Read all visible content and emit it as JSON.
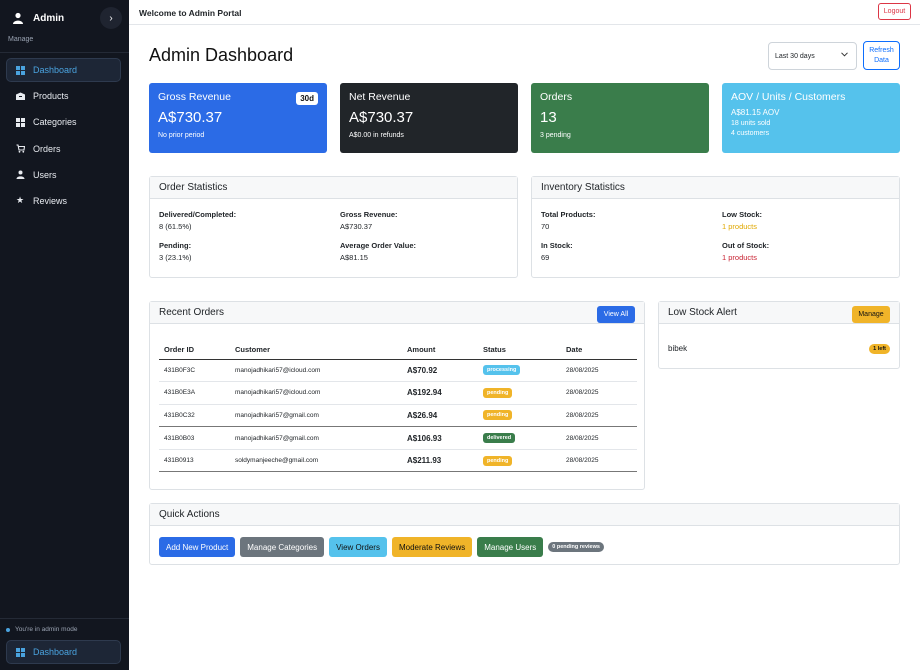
{
  "sidebar": {
    "user_name": "Admin",
    "section_label": "Manage",
    "items": [
      {
        "label": "Dashboard",
        "icon": "grid-icon",
        "active": true
      },
      {
        "label": "Products",
        "icon": "box-icon"
      },
      {
        "label": "Categories",
        "icon": "grid-icon"
      },
      {
        "label": "Orders",
        "icon": "cart-icon"
      },
      {
        "label": "Users",
        "icon": "user-icon"
      },
      {
        "label": "Reviews",
        "icon": "star-icon"
      }
    ],
    "mode_text": "You're in admin mode",
    "bottom_item": "Dashboard"
  },
  "topbar": {
    "title": "Welcome to Admin Portal",
    "logout": "Logout"
  },
  "header": {
    "title": "Admin Dashboard",
    "range_value": "Last 30 days",
    "refresh_line1": "Refresh",
    "refresh_line2": "Data"
  },
  "cards": [
    {
      "title": "Gross Revenue",
      "badge": "30d",
      "value": "A$730.37",
      "sub": "No prior period"
    },
    {
      "title": "Net Revenue",
      "value": "A$730.37",
      "sub": "A$0.00 in refunds"
    },
    {
      "title": "Orders",
      "value": "13",
      "sub": "3 pending"
    },
    {
      "title": "AOV / Units / Customers",
      "value": "A$81.15 AOV",
      "sub": "18 units sold",
      "sub2": "4 customers"
    }
  ],
  "order_stats": {
    "title": "Order Statistics",
    "delivered_label": "Delivered/Completed:",
    "delivered_value": "8 (61.5%)",
    "pending_label": "Pending:",
    "pending_value": "3 (23.1%)",
    "gross_label": "Gross Revenue:",
    "gross_value": "A$730.37",
    "aov_label": "Average Order Value:",
    "aov_value": "A$81.15"
  },
  "inventory_stats": {
    "title": "Inventory Statistics",
    "total_label": "Total Products:",
    "total_value": "70",
    "instock_label": "In Stock:",
    "instock_value": "69",
    "low_label": "Low Stock:",
    "low_value": "1 products",
    "out_label": "Out of Stock:",
    "out_value": "1 products"
  },
  "recent_orders": {
    "title": "Recent Orders",
    "view_all": "View All",
    "columns": [
      "Order ID",
      "Customer",
      "Amount",
      "Status",
      "Date"
    ],
    "rows": [
      {
        "id": "431B0F3C",
        "customer": "manojadhikari57@icloud.com",
        "amount": "A$70.92",
        "status": "processing",
        "date": "28/08/2025"
      },
      {
        "id": "431B0E3A",
        "customer": "manojadhikari57@icloud.com",
        "amount": "A$192.94",
        "status": "pending",
        "date": "28/08/2025"
      },
      {
        "id": "431B0C32",
        "customer": "manojadhikari57@gmail.com",
        "amount": "A$26.94",
        "status": "pending",
        "date": "28/08/2025"
      },
      {
        "id": "431B0B03",
        "customer": "manojadhikari57@gmail.com",
        "amount": "A$106.93",
        "status": "delivered",
        "date": "28/08/2025"
      },
      {
        "id": "431B0913",
        "customer": "soldymanjeeche@gmail.com",
        "amount": "A$211.93",
        "status": "pending",
        "date": "28/08/2025"
      }
    ]
  },
  "low_stock": {
    "title": "Low Stock Alert",
    "manage": "Manage",
    "item": "bibek",
    "item_badge": "1 left"
  },
  "quick_actions": {
    "title": "Quick Actions",
    "buttons": [
      "Add New Product",
      "Manage Categories",
      "View Orders",
      "Moderate Reviews",
      "Manage Users"
    ],
    "pill": "0 pending reviews"
  }
}
